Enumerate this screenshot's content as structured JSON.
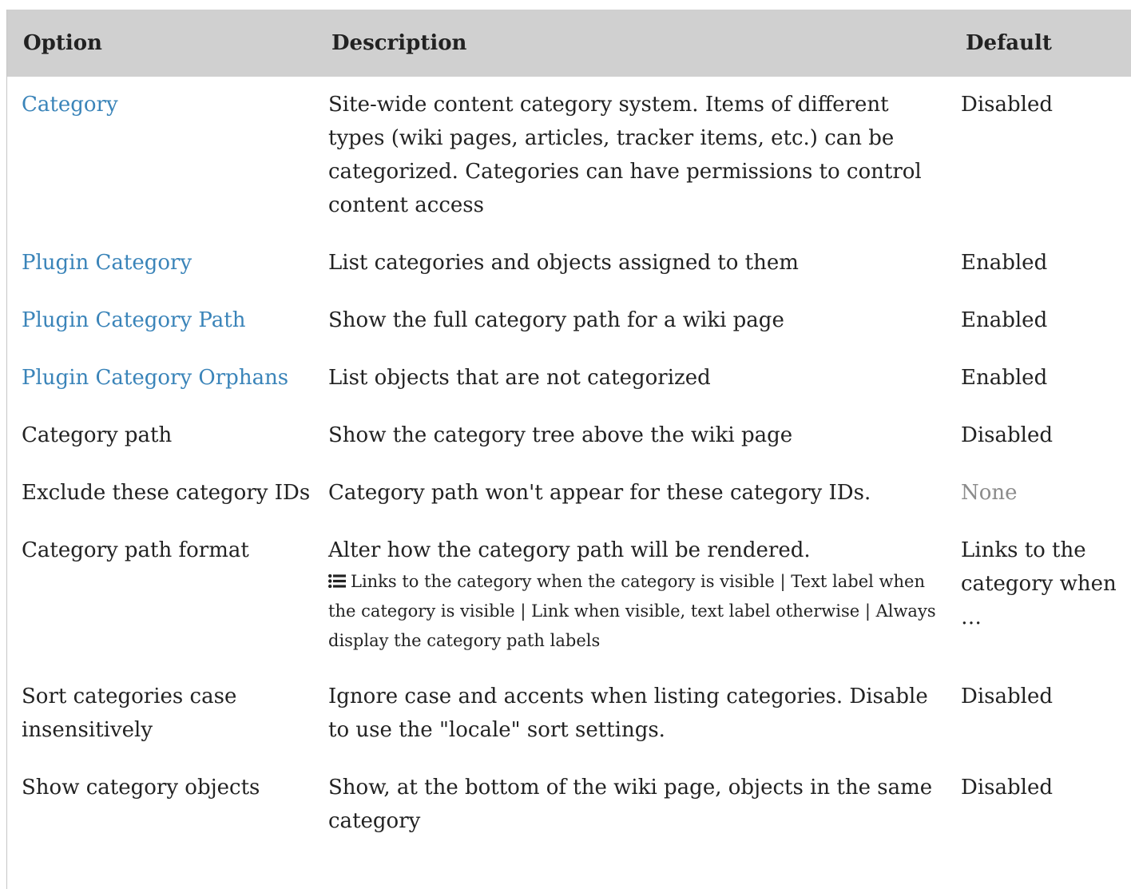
{
  "header": {
    "option": "Option",
    "description": "Description",
    "default": "Default"
  },
  "rows": [
    {
      "option": "Category",
      "link": true,
      "description": "Site-wide content category system. Items of different types (wiki pages, articles, tracker items, etc.) can be categorized. Categories can have permissions to control content access",
      "default": "Disabled"
    },
    {
      "option": "Plugin Category",
      "link": true,
      "description": "List categories and objects assigned to them",
      "default": "Enabled"
    },
    {
      "option": "Plugin Category Path",
      "link": true,
      "description": "Show the full category path for a wiki page",
      "default": "Enabled"
    },
    {
      "option": "Plugin Category Orphans",
      "link": true,
      "description": "List objects that are not categorized",
      "default": "Enabled"
    },
    {
      "option": "Category path",
      "link": false,
      "description": "Show the category tree above the wiki page",
      "default": "Disabled"
    },
    {
      "option": "Exclude these category IDs",
      "link": false,
      "description": "Category path won't appear for these category IDs.",
      "default": "None",
      "default_muted": true
    },
    {
      "option": "Category path format",
      "link": false,
      "description": "Alter how the category path will be rendered.",
      "options_text": "Links to the category when the category is visible | Text label when the category is visible | Link when visible, text label otherwise | Always display the category path labels",
      "options_icon": "list-icon",
      "default": "Links to the category when …"
    },
    {
      "option": "Sort categories case insensitively",
      "link": false,
      "description": "Ignore case and accents when listing categories. Disable to use the \"locale\" sort settings.",
      "default": "Disabled"
    },
    {
      "option": "Show category objects",
      "link": false,
      "description": "Show, at the bottom of the wiki page, objects in the same category",
      "default": "Disabled"
    }
  ],
  "colors": {
    "header_bg": "#d0d0d0",
    "link": "#3a84b9",
    "muted": "#8c8c8c",
    "text": "#222222"
  }
}
